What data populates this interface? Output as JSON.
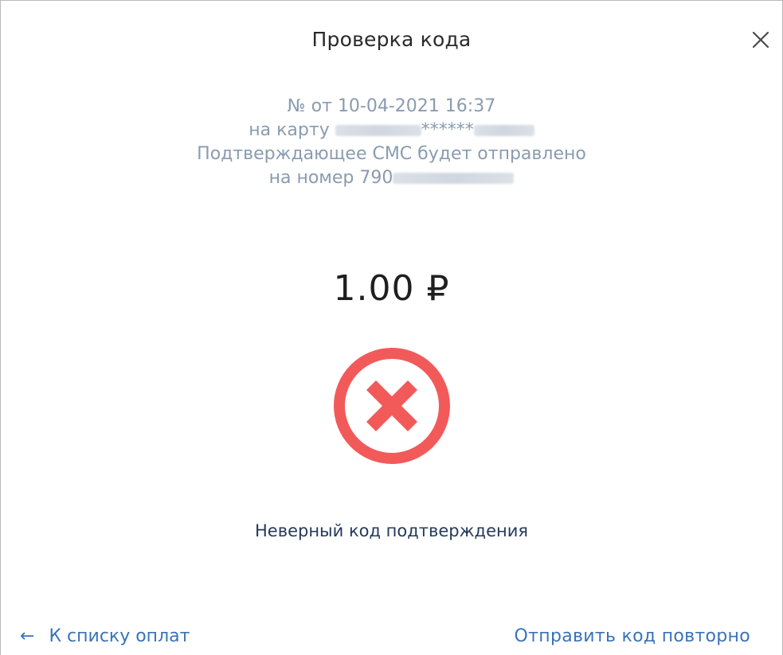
{
  "dialog": {
    "title": "Проверка кода",
    "close_icon": "close-icon"
  },
  "info": {
    "line1": "№ от 10-04-2021 16:37",
    "card_prefix": "на карту",
    "card_mask": "******",
    "line3": "Подтверждающее СМС будет отправлено",
    "phone_prefix": "на номер 790"
  },
  "amount": "1.00 ₽",
  "status": {
    "icon": "error-circle-x-icon",
    "color": "#f25a5a",
    "message": "Неверный код подтверждения"
  },
  "footer": {
    "back_arrow": "←",
    "back_label": "К списку оплат",
    "resend_label": "Отправить код повторно"
  },
  "colors": {
    "link": "#3a73b8",
    "info_text": "#8a9bb0",
    "error": "#f25a5a"
  }
}
